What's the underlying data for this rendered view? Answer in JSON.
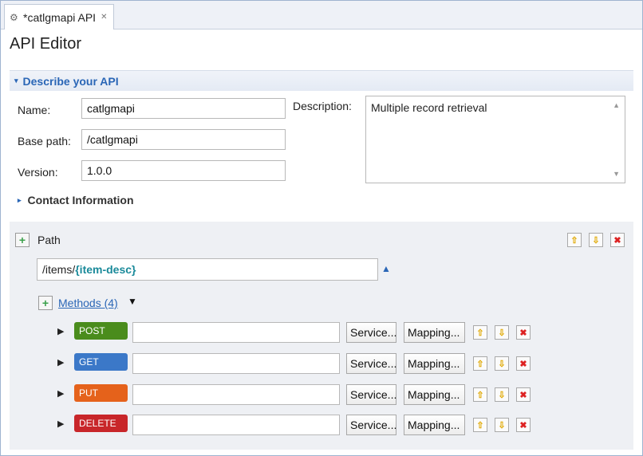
{
  "tab": {
    "title": "*catlgmapi API",
    "close": "✕"
  },
  "editor": {
    "title": "API Editor"
  },
  "describe": {
    "header": "Describe your API",
    "name_label": "Name:",
    "name_value": "catlgmapi",
    "base_path_label": "Base path:",
    "base_path_value": "/catlgmapi",
    "version_label": "Version:",
    "version_value": "1.0.0",
    "description_label": "Description:",
    "description_value": "Multiple record retrieval",
    "contact": "Contact Information"
  },
  "path": {
    "label": "Path",
    "value_prefix": "/items/",
    "value_param": "{item-desc}",
    "methods_link": "Methods (4)",
    "methods": [
      {
        "verb": "POST",
        "color": "#4a8c1c",
        "service": "Service...",
        "mapping": "Mapping..."
      },
      {
        "verb": "GET",
        "color": "#3b78c8",
        "service": "Service...",
        "mapping": "Mapping..."
      },
      {
        "verb": "PUT",
        "color": "#e5621b",
        "service": "Service...",
        "mapping": "Mapping..."
      },
      {
        "verb": "DELETE",
        "color": "#c8262a",
        "service": "Service...",
        "mapping": "Mapping..."
      }
    ]
  },
  "icons": {
    "gear": "⚙",
    "triangle_down": "▾",
    "triangle_right": "▸",
    "plus": "+",
    "up": "⇧",
    "down": "⇩",
    "delete": "✖",
    "row_arrow": "▶",
    "caret": "▼",
    "warning": "▲"
  }
}
